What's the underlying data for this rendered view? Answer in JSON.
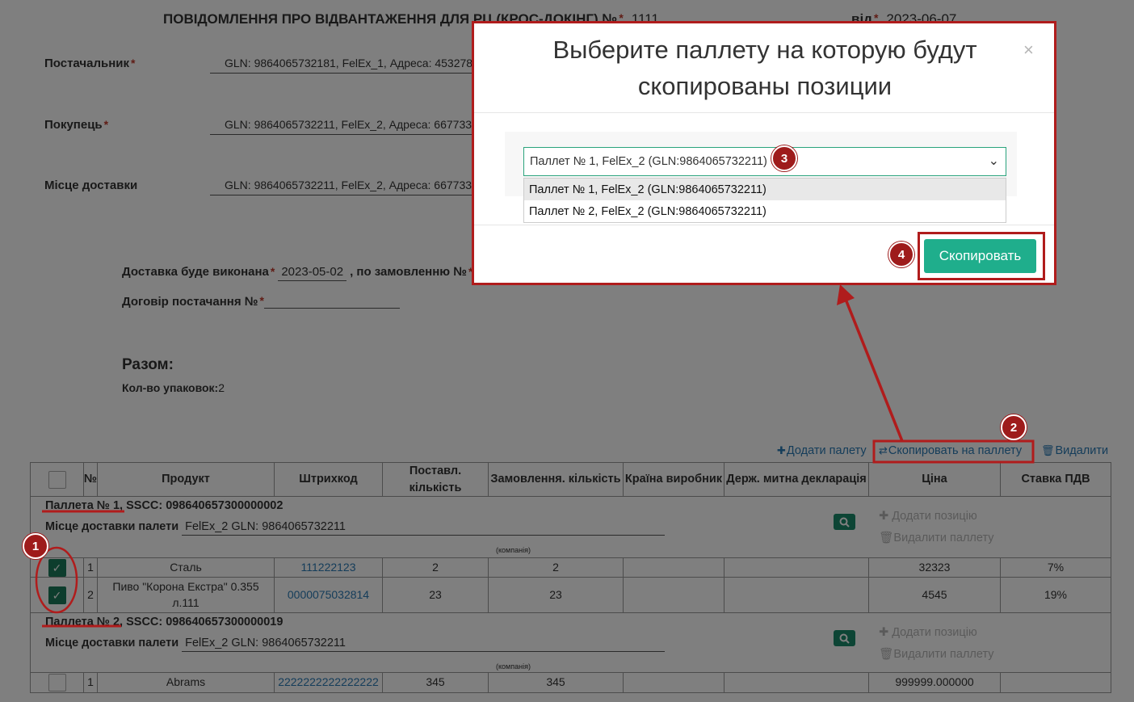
{
  "document": {
    "title": "ПОВІДОМЛЕННЯ ПРО ВІДВАНТАЖЕННЯ ДЛЯ РЦ (КРОС-ДОКІНГ) №",
    "number": "1111",
    "date_label": "від",
    "date_value": "2023-06-07"
  },
  "parties": {
    "supplier_label": "Постачальник",
    "supplier_value": "GLN: 9864065732181, FelEx_1, Адреса: 453278",
    "buyer_label": "Покупець",
    "buyer_value": "GLN: 9864065732211, FelEx_2, Адреса: 667733",
    "delivery_place_label": "Місце доставки",
    "delivery_place_value": "GLN: 9864065732211, FelEx_2, Адреса: 667733"
  },
  "delivery": {
    "will_be_label": "Доставка буде виконана",
    "date": "2023-05-02",
    "order_label": ", по замовленню №",
    "contract_label": "Договір постачання №"
  },
  "totals": {
    "title": "Разом:",
    "count_label": "Кол-во упаковок:",
    "count_value": "2"
  },
  "toolbar": {
    "add_pallet": "Додати палету",
    "copy_to_pallet": "Скопировать на паллету",
    "delete": "Видалити"
  },
  "table": {
    "columns": [
      "№",
      "Продукт",
      "Штрихкод",
      "Поставл. кількість",
      "Замовлення. кількість",
      "Країна виробник",
      "Держ. митна декларація",
      "Ціна",
      "Ставка ПДВ"
    ],
    "pallets": [
      {
        "header": "Паллета № 1, SSCC: 098640657300000002",
        "place_label": "Місце доставки палети",
        "place_value": "FelEx_2 GLN: 9864065732211",
        "company_caption": "(компанія)",
        "add_position": "Додати позицію",
        "delete_pallet": "Видалити паллету",
        "rows": [
          {
            "n": "1",
            "product": "Сталь",
            "barcode": "111222123",
            "delivered": "2",
            "ordered": "2",
            "country": "",
            "customs": "",
            "price": "32323",
            "vat": "7%"
          },
          {
            "n": "2",
            "product": "Пиво \"Корона Екстра\" 0.355 л.111",
            "barcode": "0000075032814",
            "delivered": "23",
            "ordered": "23",
            "country": "",
            "customs": "",
            "price": "4545",
            "vat": "19%"
          }
        ]
      },
      {
        "header": "Паллета № 2, SSCC: 098640657300000019",
        "place_label": "Місце доставки палети",
        "place_value": "FelEx_2 GLN: 9864065732211",
        "company_caption": "(компанія)",
        "add_position": "Додати позицію",
        "delete_pallet": "Видалити паллету",
        "rows": [
          {
            "n": "1",
            "product": "Abrams",
            "barcode": "2222222222222222",
            "delivered": "345",
            "ordered": "345",
            "country": "",
            "customs": "",
            "price": "999999.000000",
            "vat": ""
          }
        ]
      }
    ]
  },
  "modal": {
    "title": "Выберите паллету на которую будут скопированы позиции",
    "close": "×",
    "selected": "Паллет № 1, FelEx_2 (GLN:9864065732211)",
    "options": [
      "Паллет № 1, FelEx_2 (GLN:9864065732211)",
      "Паллет № 2, FelEx_2 (GLN:9864065732211)"
    ],
    "copy_button": "Скопировать"
  },
  "annotations": [
    "1",
    "2",
    "3",
    "4"
  ],
  "colors": {
    "accent_green": "#1fae8c",
    "annotation_red": "#b01c1c",
    "link_blue": "#2a7ab5"
  }
}
